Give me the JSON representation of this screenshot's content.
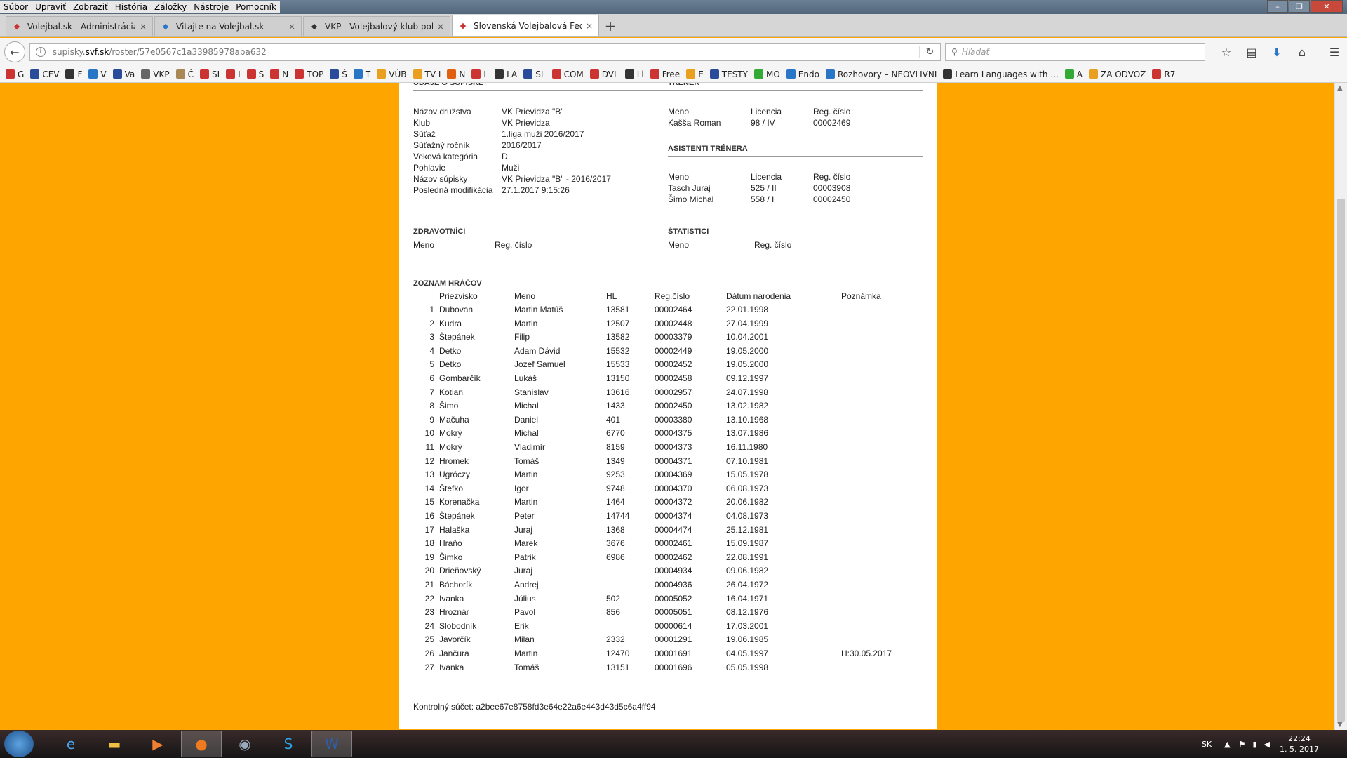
{
  "menubar": {
    "items": [
      "Súbor",
      "Upraviť",
      "Zobraziť",
      "História",
      "Záložky",
      "Nástroje",
      "Pomocník"
    ]
  },
  "tabs": [
    {
      "label": "Volejbal.sk - Administrácia",
      "close": "×"
    },
    {
      "label": "Vitajte na Volejbal.sk",
      "close": "×"
    },
    {
      "label": "VKP - Volejbalový klub polície Br",
      "close": "×"
    },
    {
      "label": "Slovenská Volejbalová Federá",
      "close": "×"
    }
  ],
  "newtab": "+",
  "url": {
    "prefix": "supisky.",
    "host": "svf.sk",
    "path": "/roster/57e0567c1a33985978aba632"
  },
  "search": {
    "placeholder": "Hľadať"
  },
  "bookmarks": [
    "G",
    "CEV",
    "F",
    "V",
    "Va",
    "VKP",
    "Č",
    "SI",
    "I",
    "S",
    "N",
    "TOP",
    "Š",
    "T",
    "VÚB",
    "TV I",
    "N",
    "L",
    "LA",
    "SL",
    "COM",
    "DVL",
    "Li",
    "Free",
    "E",
    "TESTY",
    "MO",
    "Endo",
    "Rozhovory – NEOVLIVNI",
    "Learn Languages with ...",
    "A",
    "ZA ODVOZ",
    "R7"
  ],
  "roster": {
    "headers": {
      "supiska": "ÚDAJE O SÚPISKE",
      "trener": "TRÉNER",
      "asistenti": "ASISTENTI TRÉNERA",
      "zdravotnici": "ZDRAVOTNÍCI",
      "statistici": "ŠTATISTICI",
      "hraci": "ZOZNAM HRÁČOV"
    },
    "info": [
      {
        "k": "Názov družstva",
        "v": "VK Prievidza \"B\""
      },
      {
        "k": "Klub",
        "v": "VK Prievidza"
      },
      {
        "k": "Súťaž",
        "v": "1.liga muži 2016/2017"
      },
      {
        "k": "Súťažný ročník",
        "v": "2016/2017"
      },
      {
        "k": "Veková kategória",
        "v": "D"
      },
      {
        "k": "Pohlavie",
        "v": "Muži"
      },
      {
        "k": "Názov súpisky",
        "v": "VK Prievidza \"B\" - 2016/2017"
      },
      {
        "k": "Posledná modifikácia",
        "v": "27.1.2017 9:15:26"
      }
    ],
    "coach_cols": [
      "Meno",
      "Licencia",
      "Reg. číslo"
    ],
    "coach": {
      "meno": "Kašša Roman",
      "licencia": "98 / IV",
      "reg": "00002469"
    },
    "assistants": [
      {
        "meno": "Tasch Juraj",
        "licencia": "525 / II",
        "reg": "00003908"
      },
      {
        "meno": "Šimo Michal",
        "licencia": "558 / I",
        "reg": "00002450"
      }
    ],
    "medic_cols": [
      "Meno",
      "Reg. číslo"
    ],
    "stat_cols": [
      "Meno",
      "Reg. číslo"
    ],
    "player_cols": [
      "Priezvisko",
      "Meno",
      "HL",
      "Reg.číslo",
      "Dátum narodenia",
      "Poznámka"
    ],
    "players": [
      [
        "1",
        "Dubovan",
        "Martin Matúš",
        "13581",
        "00002464",
        "22.01.1998",
        ""
      ],
      [
        "2",
        "Kudra",
        "Martin",
        "12507",
        "00002448",
        "27.04.1999",
        ""
      ],
      [
        "3",
        "Štepánek",
        "Filip",
        "13582",
        "00003379",
        "10.04.2001",
        ""
      ],
      [
        "4",
        "Detko",
        "Adam Dávid",
        "15532",
        "00002449",
        "19.05.2000",
        ""
      ],
      [
        "5",
        "Detko",
        "Jozef Samuel",
        "15533",
        "00002452",
        "19.05.2000",
        ""
      ],
      [
        "6",
        "Gombarčík",
        "Lukáš",
        "13150",
        "00002458",
        "09.12.1997",
        ""
      ],
      [
        "7",
        "Kotian",
        "Stanislav",
        "13616",
        "00002957",
        "24.07.1998",
        ""
      ],
      [
        "8",
        "Šimo",
        "Michal",
        "1433",
        "00002450",
        "13.02.1982",
        ""
      ],
      [
        "9",
        "Mačuha",
        "Daniel",
        "401",
        "00003380",
        "13.10.1968",
        ""
      ],
      [
        "10",
        "Mokrý",
        "Michal",
        "6770",
        "00004375",
        "13.07.1986",
        ""
      ],
      [
        "11",
        "Mokrý",
        "Vladimír",
        "8159",
        "00004373",
        "16.11.1980",
        ""
      ],
      [
        "12",
        "Hromek",
        "Tomáš",
        "1349",
        "00004371",
        "07.10.1981",
        ""
      ],
      [
        "13",
        "Ugróczy",
        "Martin",
        "9253",
        "00004369",
        "15.05.1978",
        ""
      ],
      [
        "14",
        "Štefko",
        "Igor",
        "9748",
        "00004370",
        "06.08.1973",
        ""
      ],
      [
        "15",
        "Korenačka",
        "Martin",
        "1464",
        "00004372",
        "20.06.1982",
        ""
      ],
      [
        "16",
        "Štepánek",
        "Peter",
        "14744",
        "00004374",
        "04.08.1973",
        ""
      ],
      [
        "17",
        "Halaška",
        "Juraj",
        "1368",
        "00004474",
        "25.12.1981",
        ""
      ],
      [
        "18",
        "Hraňo",
        "Marek",
        "3676",
        "00002461",
        "15.09.1987",
        ""
      ],
      [
        "19",
        "Šimko",
        "Patrik",
        "6986",
        "00002462",
        "22.08.1991",
        ""
      ],
      [
        "20",
        "Drieňovský",
        "Juraj",
        "",
        "00004934",
        "09.06.1982",
        ""
      ],
      [
        "21",
        "Báchorík",
        "Andrej",
        "",
        "00004936",
        "26.04.1972",
        ""
      ],
      [
        "22",
        "Ivanka",
        "Július",
        "502",
        "00005052",
        "16.04.1971",
        ""
      ],
      [
        "23",
        "Hroznár",
        "Pavol",
        "856",
        "00005051",
        "08.12.1976",
        ""
      ],
      [
        "24",
        "Slobodník",
        "Erik",
        "",
        "00000614",
        "17.03.2001",
        ""
      ],
      [
        "25",
        "Javorčík",
        "Milan",
        "2332",
        "00001291",
        "19.06.1985",
        ""
      ],
      [
        "26",
        "Jančura",
        "Martin",
        "12470",
        "00001691",
        "04.05.1997",
        "H:30.05.2017"
      ],
      [
        "27",
        "Ivanka",
        "Tomáš",
        "13151",
        "00001696",
        "05.05.1998",
        ""
      ]
    ],
    "checksum": "Kontrolný súčet: a2bee67e8758fd3e64e22a6e443d43d5c6a4ff94"
  },
  "taskbar": {
    "lang": "SK",
    "time": "22:24",
    "date": "1. 5. 2017"
  }
}
